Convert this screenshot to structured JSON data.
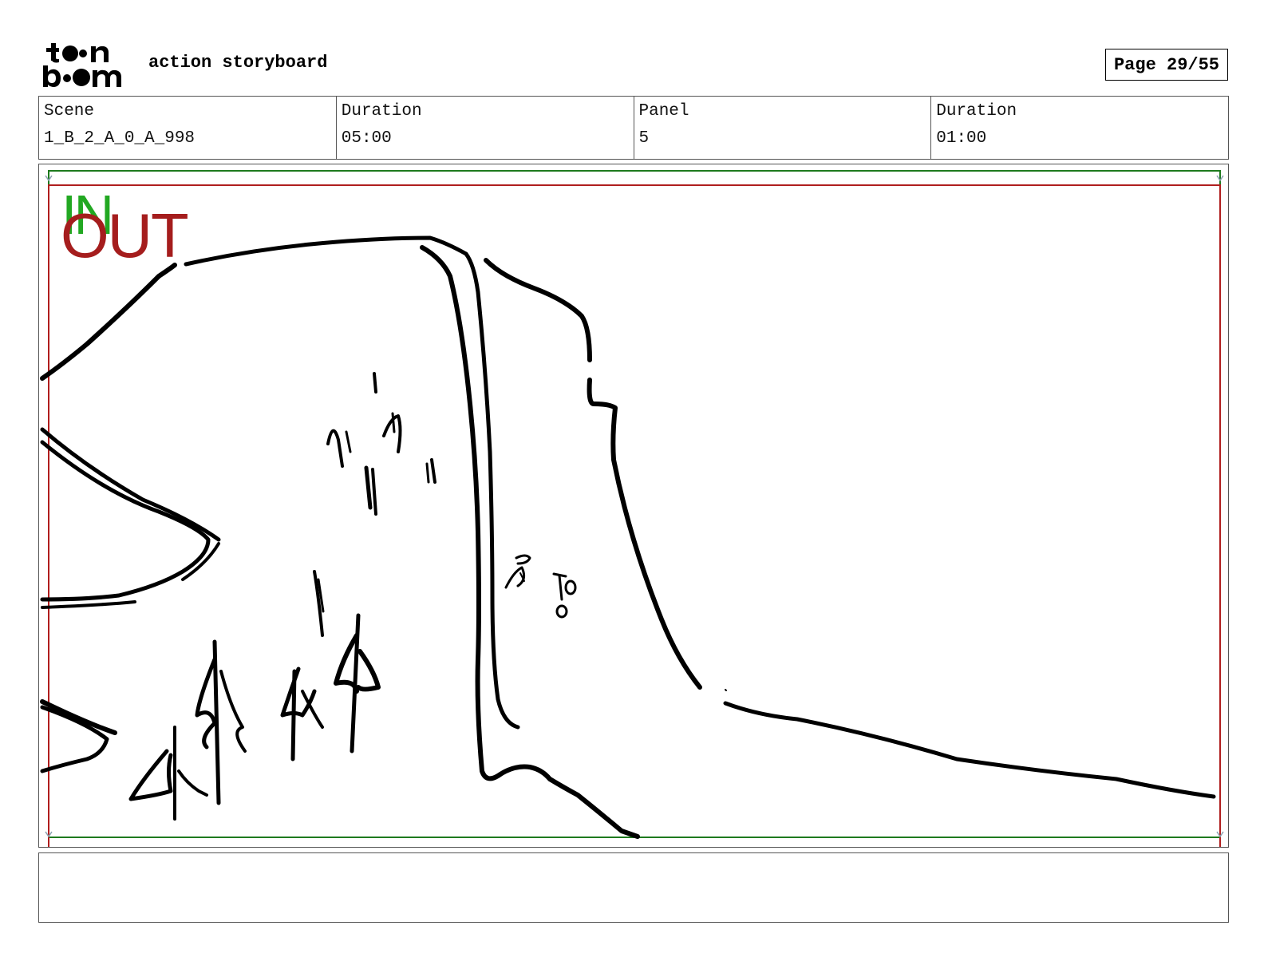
{
  "header": {
    "logo_text": "toon boom",
    "title": "action storyboard",
    "page_label": "Page 29/55"
  },
  "info": {
    "scene_label": "Scene",
    "scene_value": "1_B_2_A_0_A_998",
    "scene_duration_label": "Duration",
    "scene_duration_value": "05:00",
    "panel_label": "Panel",
    "panel_value": "5",
    "panel_duration_label": "Duration",
    "panel_duration_value": "01:00"
  },
  "panel": {
    "in_label": "IN",
    "out_label": "OUT",
    "colors": {
      "in_frame": "#1e7a1e",
      "out_frame": "#b01e1e",
      "sketch": "#000000"
    }
  },
  "notes": {
    "text": ""
  }
}
